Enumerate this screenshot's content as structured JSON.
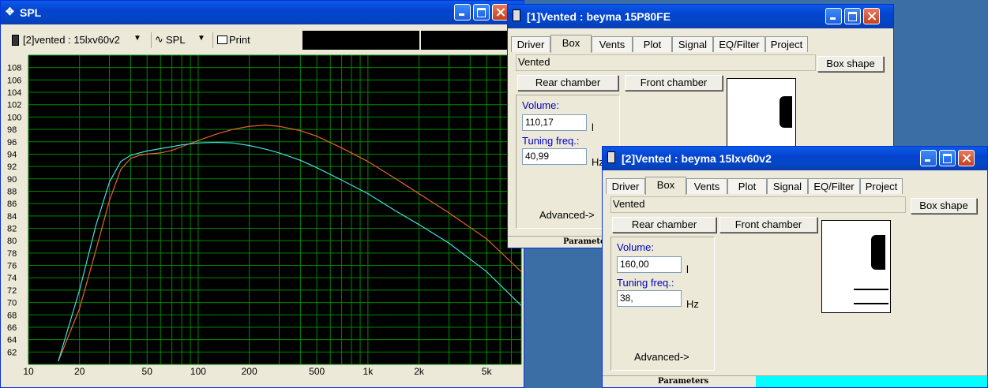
{
  "spl_window": {
    "title": "SPL",
    "driver_select": "[2]vented : 15lxv60v2",
    "mode_select": "SPL",
    "print_label": "Print",
    "y_ticks": [
      "108",
      "106",
      "104",
      "102",
      "100",
      "98",
      "96",
      "94",
      "92",
      "90",
      "88",
      "86",
      "84",
      "82",
      "80",
      "78",
      "76",
      "74",
      "72",
      "70",
      "68",
      "66",
      "64",
      "62"
    ],
    "x_ticks": [
      "10",
      "20",
      "50",
      "100",
      "200",
      "500",
      "1k",
      "2k",
      "5k"
    ]
  },
  "chart_data": {
    "type": "line",
    "xscale": "log",
    "xlim": [
      10,
      8000
    ],
    "ylim": [
      60,
      110
    ],
    "grid": true,
    "series": [
      {
        "color": "#e8642a",
        "x": [
          15,
          20,
          25,
          30,
          35,
          40,
          45,
          50,
          60,
          70,
          80,
          100,
          130,
          160,
          200,
          250,
          300,
          400,
          500,
          700,
          1000,
          1500,
          2000,
          3000,
          5000,
          8000
        ],
        "y": [
          60.5,
          69,
          78.5,
          86.5,
          91.5,
          93.3,
          93.8,
          94.0,
          94.2,
          94.6,
          95.2,
          96.2,
          97.3,
          98.0,
          98.5,
          98.7,
          98.5,
          97.8,
          96.9,
          95.0,
          92.8,
          89.8,
          87.6,
          84.5,
          80.3,
          75.0
        ]
      },
      {
        "color": "#40e0e0",
        "x": [
          15,
          20,
          25,
          30,
          35,
          40,
          45,
          50,
          60,
          70,
          80,
          100,
          130,
          160,
          200,
          250,
          300,
          400,
          500,
          700,
          1000,
          1500,
          2000,
          3000,
          5000,
          8000
        ],
        "y": [
          60.5,
          72,
          82.5,
          89.5,
          92.8,
          93.8,
          94.2,
          94.5,
          94.9,
          95.2,
          95.5,
          95.8,
          95.9,
          95.8,
          95.4,
          94.8,
          94.2,
          93.0,
          91.8,
          89.8,
          87.6,
          84.6,
          82.6,
          79.6,
          75.0,
          69.5
        ]
      }
    ]
  },
  "win1": {
    "title": "[1]Vented : beyma  15P80FE",
    "tabs": [
      "Driver",
      "Box",
      "Vents",
      "Plot",
      "Signal",
      "EQ/Filter",
      "Project"
    ],
    "active_tab": "Box",
    "box_type": "Vented",
    "box_shape_label": "Box shape",
    "rear_chamber_label": "Rear chamber",
    "front_chamber_label": "Front chamber",
    "volume_label": "Volume:",
    "volume_value": "110,17",
    "volume_unit": "l",
    "tuning_label": "Tuning freq.:",
    "tuning_value": "40,99",
    "tuning_unit": "Hz",
    "advanced_label": "Advanced->",
    "status": "Parameters"
  },
  "win2": {
    "title": "[2]Vented : beyma 15lxv60v2",
    "tabs": [
      "Driver",
      "Box",
      "Vents",
      "Plot",
      "Signal",
      "EQ/Filter",
      "Project"
    ],
    "active_tab": "Box",
    "box_type": "Vented",
    "box_shape_label": "Box shape",
    "rear_chamber_label": "Rear chamber",
    "front_chamber_label": "Front chamber",
    "volume_label": "Volume:",
    "volume_value": "160,00",
    "volume_unit": "l",
    "tuning_label": "Tuning freq.:",
    "tuning_value": "38,",
    "tuning_unit": "Hz",
    "advanced_label": "Advanced->",
    "status": "Parameters"
  },
  "colors": {
    "chart_bg": "#000000",
    "grid": "#008800",
    "axis_text": "#000000"
  }
}
